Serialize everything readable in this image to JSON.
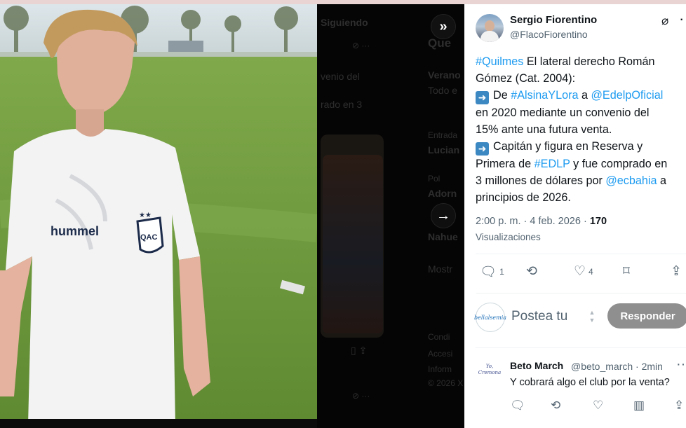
{
  "viewer": {
    "image_caption_hint": "",
    "next_icon": "chevron-right-icon",
    "collapse_icon": "double-chevron-right-icon"
  },
  "background": {
    "tab_following": "Siguiendo",
    "snippet_1": "venio del",
    "snippet_2": "rado en 3",
    "side_1": "Que",
    "side_2": "Verano",
    "side_3": "Todo e",
    "side_4": "Entrada",
    "side_5": "Lucian",
    "side_6": "Pol",
    "side_7": "Adorn",
    "side_8": "Nahue",
    "side_9": "Mostr",
    "side_10": "Condi",
    "side_11": "Accesi",
    "side_12": "Inform",
    "side_13": "© 2026 X"
  },
  "tweet": {
    "author_name": "Sergio Fiorentino",
    "author_handle": "@FlacoFiorentino",
    "line1_tag": "#Quilmes",
    "line1_text": " El lateral derecho Román",
    "line2": "Gómez (Cat. 2004):",
    "line3_pre": "De ",
    "line3_tag": "#AlsinaYLora",
    "line3_mid": " a ",
    "line3_tag2": "@EdelpOficial",
    "line4": "en 2020 mediante un convenio del",
    "line5": "15% ante una futura venta.",
    "line6": "Capitán y figura en Reserva y",
    "line7_pre": "Primera de ",
    "line7_tag": "#EDLP",
    "line7_post": " y fue comprado en",
    "line8_pre": "3 millones de dólares por ",
    "line8_tag": "@ecbahia",
    "line8_post": " a",
    "line9": "principios de 2026.",
    "time": "2:00 p. m. · 4 feb. 2026 · ",
    "view_count": "170",
    "views_label": "Visualizaciones",
    "replies": "1",
    "reposts": "",
    "likes": "4"
  },
  "reply_box": {
    "placeholder": "Postea tu",
    "button": "Responder",
    "avatar_text": "bellalsemia"
  },
  "comment": {
    "author": "Beto March",
    "handle": "@beto_march · 2min",
    "text": "Y cobrará algo el club por la venta?",
    "avatar_text": "Yo, Cremona"
  },
  "colors": {
    "link": "#1d9bf0",
    "reply_button": "#8f8f8f",
    "arrow_emoji": "#3b88c3"
  }
}
